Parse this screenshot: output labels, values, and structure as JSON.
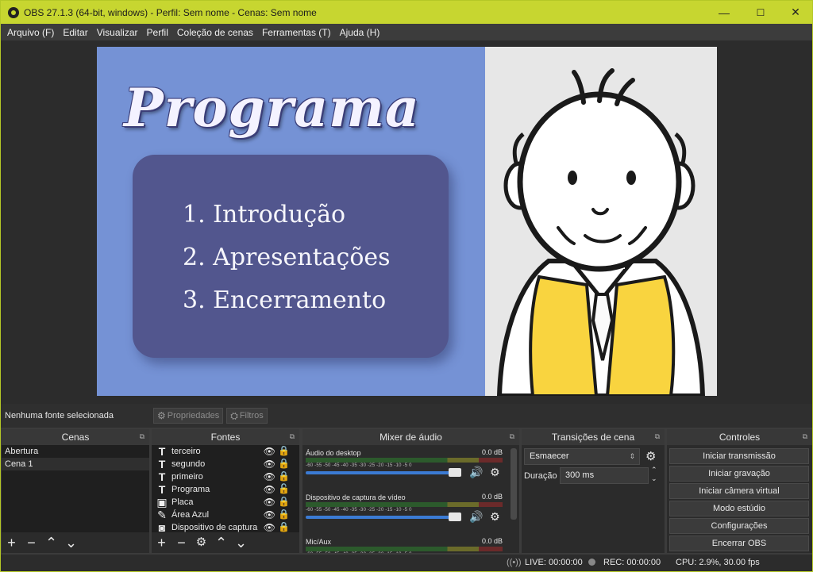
{
  "window": {
    "title": "OBS 27.1.3 (64-bit, windows) - Perfil: Sem nome - Cenas: Sem nome",
    "minimize": "—",
    "maximize": "☐",
    "close": "✕"
  },
  "menu": [
    "Arquivo (F)",
    "Editar",
    "Visualizar",
    "Perfil",
    "Coleção de cenas",
    "Ferramentas (T)",
    "Ajuda (H)"
  ],
  "preview": {
    "heading": "Programa",
    "items": [
      "1. Introdução",
      "2. Apresentações",
      "3. Encerramento"
    ],
    "colors": {
      "background_left": "#7592d5",
      "plaque": "#52568e",
      "background_right": "#e7e7e7",
      "vest": "#f9d43f"
    }
  },
  "sourcebar": {
    "no_source": "Nenhuma fonte selecionada",
    "properties": "Propriedades",
    "filters": "Filtros"
  },
  "scenes": {
    "title": "Cenas",
    "items": [
      "Abertura",
      "Cena 1"
    ],
    "selected": "Cena 1"
  },
  "sources": {
    "title": "Fontes",
    "items": [
      {
        "label": "terceiro",
        "icon": "text-icon"
      },
      {
        "label": "segundo",
        "icon": "text-icon"
      },
      {
        "label": "primeiro",
        "icon": "text-icon"
      },
      {
        "label": "Programa",
        "icon": "text-icon"
      },
      {
        "label": "Placa",
        "icon": "image-icon"
      },
      {
        "label": "Área Azul",
        "icon": "brush-icon"
      },
      {
        "label": "Dispositivo de captura",
        "icon": "camera-icon"
      }
    ]
  },
  "mixer": {
    "title": "Mixer de áudio",
    "ticks": "-60 -55 -50 -45 -40 -35 -30 -25 -20 -15 -10 -5 0",
    "channels": [
      {
        "name": "Áudio do desktop",
        "db": "0.0 dB"
      },
      {
        "name": "Dispositivo de captura de vídeo",
        "db": "0.0 dB"
      },
      {
        "name": "Mic/Aux",
        "db": "0.0 dB"
      }
    ]
  },
  "transitions": {
    "title": "Transições de cena",
    "selected": "Esmaecer",
    "duration_label": "Duração",
    "duration_value": "300 ms"
  },
  "controls": {
    "title": "Controles",
    "buttons": [
      "Iniciar transmissão",
      "Iniciar gravação",
      "Iniciar câmera virtual",
      "Modo estúdio",
      "Configurações",
      "Encerrar OBS"
    ]
  },
  "status": {
    "live": "LIVE: 00:00:00",
    "rec": "REC: 00:00:00",
    "cpu": "CPU: 2.9%, 30.00 fps"
  }
}
